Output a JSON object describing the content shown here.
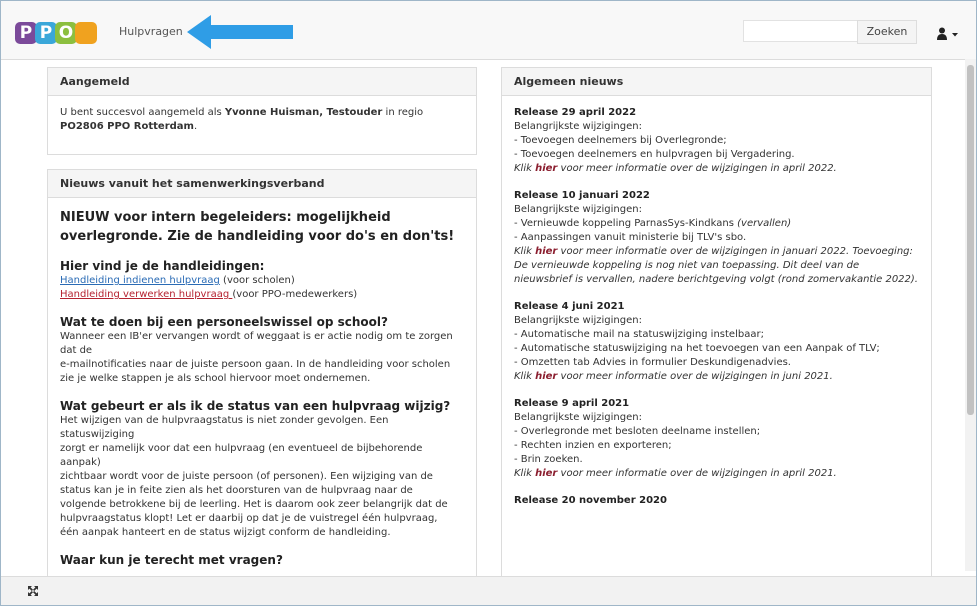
{
  "navbar": {
    "logo_letters": [
      "P",
      "P",
      "O"
    ],
    "logo_colors": [
      "#7b4a9a",
      "#3aa7d9",
      "#8cbf3f"
    ],
    "link": "Hulpvragen",
    "search_placeholder": "",
    "search_button": "Zoeken",
    "arrow_color": "#2f9de6"
  },
  "panel_aangemeld": {
    "title": "Aangemeld",
    "text_prefix": "U bent succesvol aangemeld als ",
    "user": "Yvonne Huisman, Testouder",
    "text_mid": " in regio ",
    "region": "PO2806 PPO Rotterdam",
    "text_suffix": "."
  },
  "panel_nieuws_swv": {
    "title": "Nieuws vanuit het samenwerkingsverband",
    "headline": "NIEUW voor intern begeleiders: mogelijkheid overlegronde. Zie de handleiding voor do's en don'ts!",
    "handleidingen_title": "Hier vind je de handleidingen:",
    "link1": "Handleiding indienen hulpvraag",
    "link1_suffix": " (voor scholen)",
    "link2": "Handleiding verwerken hulpvraag ",
    "link2_suffix": "(voor PPO-medewerkers)",
    "q1_title": "Wat te doen bij een personeelswissel op school?",
    "q1_lines": [
      "Wanneer een IB'er vervangen wordt of weggaat is er actie nodig om te zorgen dat de",
      "e-mailnotificaties naar de juiste persoon gaan. In de handleiding voor scholen",
      "zie je welke stappen je als school hiervoor moet ondernemen."
    ],
    "q2_title": "Wat gebeurt er als ik de status van een hulpvraag wijzig?",
    "q2_lines": [
      "Het wijzigen van de hulpvraagstatus is niet zonder gevolgen. Een statuswijziging",
      "zorgt er namelijk voor dat een hulpvraag (en eventueel de bijbehorende aanpak)",
      "zichtbaar wordt voor de juiste persoon (of personen). Een wijziging van de",
      "status kan je in feite zien als het doorsturen van de hulpvraag naar de",
      "volgende betrokkene bij de leerling. Het is daarom ook zeer belangrijk dat de",
      "hulpvraagstatus klopt! Let er daarbij op dat je de vuistregel één hulpvraag,",
      "één aanpak hanteert en de status wijzigt conform de handleiding."
    ],
    "q3_title": "Waar kun je terecht met vragen?"
  },
  "panel_algemeen": {
    "title": "Algemeen nieuws",
    "releases": [
      {
        "title": "Release 29 april 2022",
        "intro": "Belangrijkste wijzigingen:",
        "items": [
          "- Toevoegen deelnemers bij Overlegronde;",
          "- Toevoegen deelnemers en hulpvragen bij Vergadering."
        ],
        "klik": "Klik ",
        "hier": "hier",
        "rest": " voor meer informatie over de wijzigingen in april 2022."
      },
      {
        "title": "Release 10 januari 2022",
        "intro": "Belangrijkste wijzigingen:",
        "items": [
          "- Vernieuwde koppeling ParnasSys-Kindkans (vervallen)",
          "- Aanpassingen vanuit ministerie bij TLV's sbo."
        ],
        "klik": "Klik ",
        "hier": "hier",
        "rest": " voor meer informatie over de wijzigingen in januari 2022. Toevoeging: De vernieuwde koppeling is nog niet van toepassing. Dit deel van de nieuwsbrief is vervallen, nadere berichtgeving volgt (rond zomervakantie 2022)."
      },
      {
        "title": "Release 4 juni 2021",
        "intro": "Belangrijkste wijzigingen:",
        "items": [
          "- Automatische mail na statuswijziging instelbaar;",
          "- Automatische statuswijziging na het toevoegen van een Aanpak of TLV;",
          "- Omzetten tab Advies in formulier Deskundigenadvies."
        ],
        "klik": "Klik ",
        "hier": "hier",
        "rest": " voor meer informatie over de wijzigingen in juni 2021."
      },
      {
        "title": "Release 9 april 2021",
        "intro": "Belangrijkste wijzigingen:",
        "items": [
          "- Overlegronde met besloten deelname instellen;",
          "- Rechten inzien en exporteren;",
          "- Brin zoeken."
        ],
        "klik": "Klik ",
        "hier": "hier",
        "rest": " voor meer informatie over de wijzigingen in april 2021."
      },
      {
        "title": "Release 20 november 2020",
        "intro": "",
        "items": [],
        "klik": "",
        "hier": "",
        "rest": ""
      }
    ]
  }
}
